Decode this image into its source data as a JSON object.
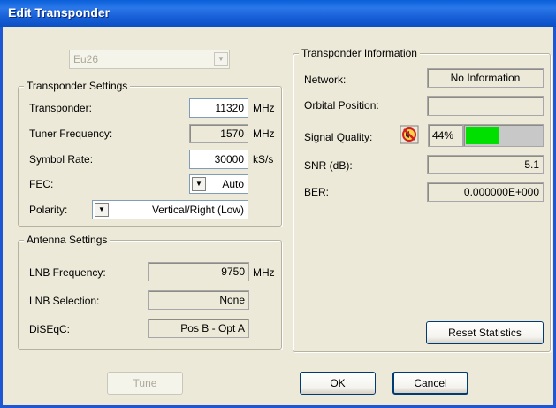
{
  "window": {
    "title": "Edit Transponder"
  },
  "satellite_select": {
    "value": "Eu26"
  },
  "transponder_settings": {
    "legend": "Transponder Settings",
    "transponder": {
      "label": "Transponder:",
      "value": "11320",
      "unit": "MHz"
    },
    "tuner_frequency": {
      "label": "Tuner Frequency:",
      "value": "1570",
      "unit": "MHz"
    },
    "symbol_rate": {
      "label": "Symbol Rate:",
      "value": "30000",
      "unit": "kS/s"
    },
    "fec": {
      "label": "FEC:",
      "value": "Auto"
    },
    "polarity": {
      "label": "Polarity:",
      "value": "Vertical/Right (Low)"
    }
  },
  "antenna_settings": {
    "legend": "Antenna Settings",
    "lnb_frequency": {
      "label": "LNB Frequency:",
      "value": "9750",
      "unit": "MHz"
    },
    "lnb_selection": {
      "label": "LNB Selection:",
      "value": "None"
    },
    "diseqc": {
      "label": "DiSEqC:",
      "value": "Pos B - Opt A"
    }
  },
  "transponder_information": {
    "legend": "Transponder Information",
    "network": {
      "label": "Network:",
      "value": "No Information"
    },
    "orbital_position": {
      "label": "Orbital Position:",
      "value": ""
    },
    "signal_quality": {
      "label": "Signal Quality:",
      "percent_text": "44%",
      "level": 0.44,
      "icon": "signal-alert-icon",
      "bar_color": "#00e000"
    },
    "snr": {
      "label": "SNR (dB):",
      "value": "5.1"
    },
    "ber": {
      "label": "BER:",
      "value": "0.000000E+000"
    },
    "reset_label": "Reset Statistics"
  },
  "buttons": {
    "tune": "Tune",
    "ok": "OK",
    "cancel": "Cancel"
  }
}
